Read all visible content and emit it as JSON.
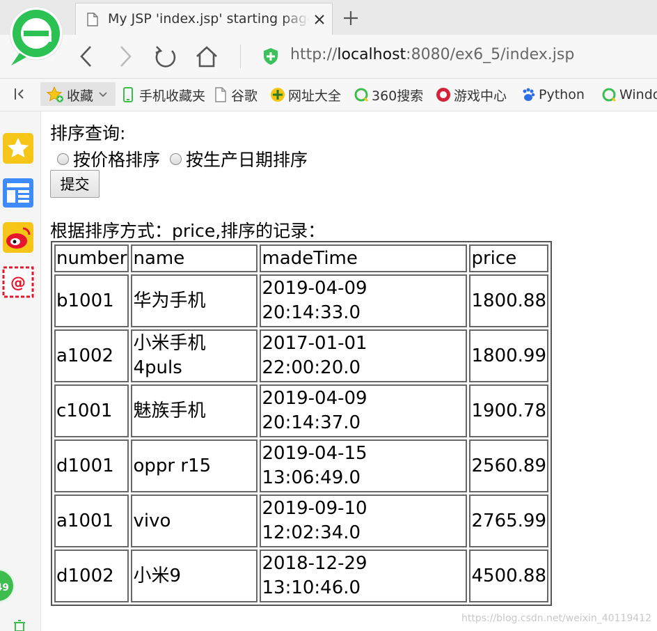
{
  "browser": {
    "tab_title": "My JSP 'index.jsp' starting page",
    "new_tab_symbol": "+",
    "url_protocol": "http://",
    "url_host": "localhost",
    "url_rest": ":8080/ex6_5/index.jsp",
    "bookmarks_toggle": "<|",
    "favorites_label": "收藏",
    "bookmarks": [
      {
        "label": "手机收藏夹",
        "icon": "phone-icon"
      },
      {
        "label": "谷歌",
        "icon": "page-icon"
      },
      {
        "label": "网址大全",
        "icon": "plus-globe-icon"
      },
      {
        "label": "360搜索",
        "icon": "search360-icon"
      },
      {
        "label": "游戏中心",
        "icon": "game-icon"
      },
      {
        "label": "Python",
        "icon": "baidu-paw-icon"
      },
      {
        "label": "Windo",
        "icon": "search360-icon"
      }
    ],
    "sidebar_badge": "49",
    "colors": {
      "accent_green": "#3cbd4d",
      "secure_green": "#3cc25a",
      "sidebar_star": "#f5c518",
      "sidebar_news": "#3d8bfd",
      "sidebar_weibo": "#e6162d"
    }
  },
  "page": {
    "sort_label": "排序查询:",
    "radios": [
      {
        "label": "按价格排序",
        "checked": false
      },
      {
        "label": "按生产日期排序",
        "checked": false
      }
    ],
    "submit_label": "提交",
    "result_heading": "根据排序方式：price,排序的记录：",
    "table": {
      "headers": [
        "number",
        "name",
        "madeTime",
        "price"
      ],
      "rows": [
        [
          "b1001",
          "华为手机",
          "2019-04-09\n20:14:33.0",
          "1800.88"
        ],
        [
          "a1002",
          "小米手机\n4puls",
          "2017-01-01\n22:00:20.0",
          "1800.99"
        ],
        [
          "c1001",
          "魅族手机",
          "2019-04-09\n20:14:37.0",
          "1900.78"
        ],
        [
          "d1001",
          "oppr r15",
          "2019-04-15\n13:06:49.0",
          "2560.89"
        ],
        [
          "a1001",
          "vivo",
          "2019-09-10\n12:02:34.0",
          "2765.99"
        ],
        [
          "d1002",
          "小米9",
          "2018-12-29\n13:10:46.0",
          "4500.88"
        ]
      ]
    },
    "watermark": "https://blog.csdn.net/weixin_40119412"
  }
}
